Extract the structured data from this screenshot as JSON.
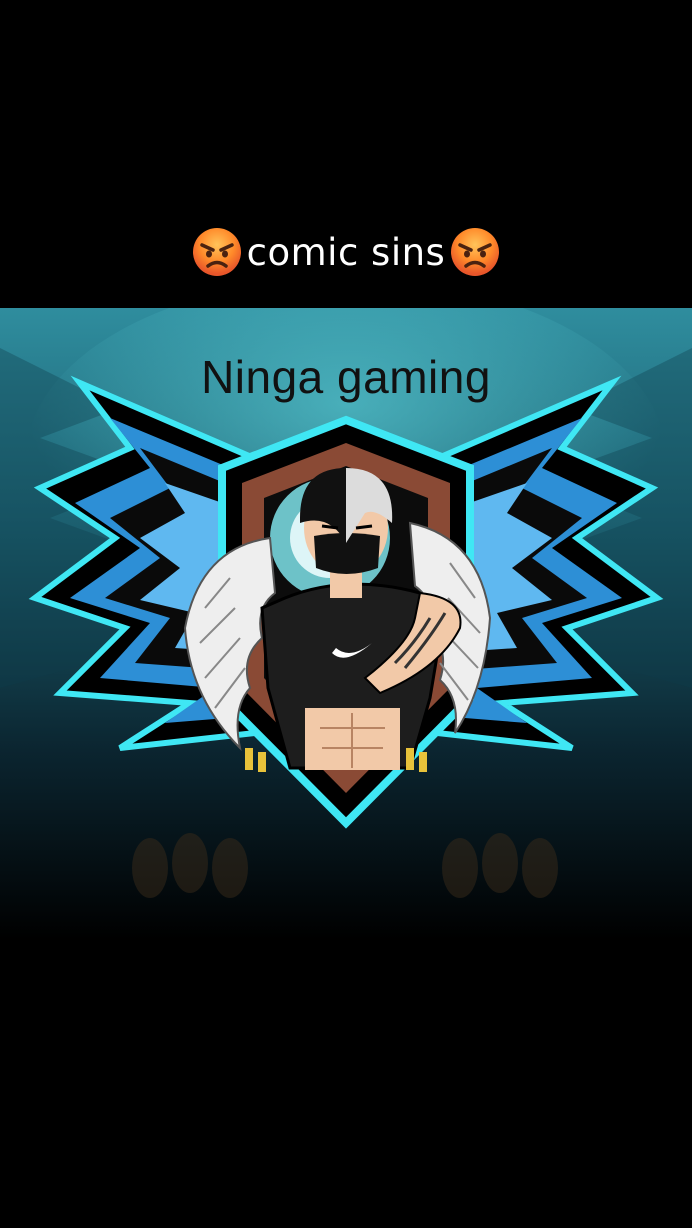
{
  "caption": {
    "text": "comic sins",
    "emoji_icon": "angry-face-icon"
  },
  "artwork": {
    "title": "Ninga gaming",
    "colors": {
      "background_teal": "#1b5e6e",
      "neon_cyan": "#3fe7f4",
      "wing_blue": "#2d8fd6",
      "shield_brown": "#8a4a35"
    }
  }
}
